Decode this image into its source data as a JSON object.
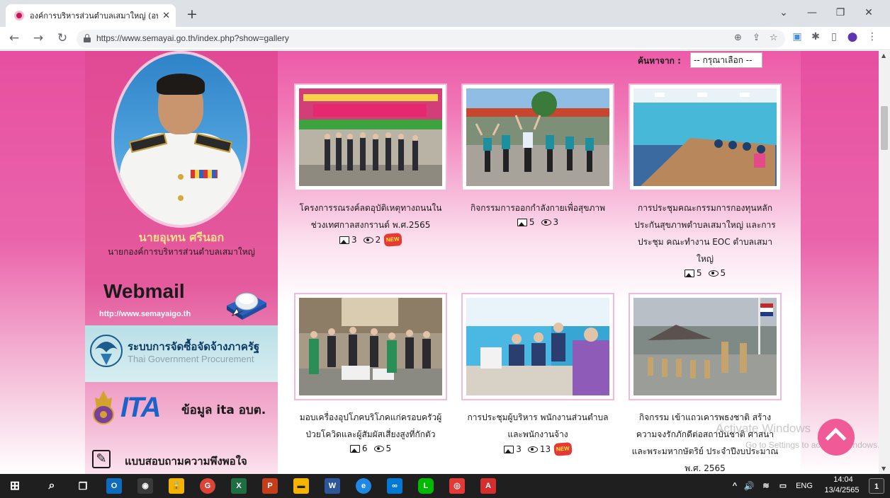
{
  "browser": {
    "tab_title": "องค์การบริหารส่วนตำบลเสมาใหญ่ (อบ",
    "tab_close": "✕",
    "new_tab": "+",
    "window_controls": {
      "dropdown": "⌄",
      "minimize": "—",
      "restore": "❐",
      "close": "✕"
    },
    "nav": {
      "back": "←",
      "forward": "→",
      "reload": "↻"
    },
    "url": "https://www.semayai.go.th/index.php?show=gallery",
    "omnibox_icons": {
      "zoom": "⊕",
      "share": "⇪",
      "bookmark": "☆"
    },
    "extension_icons": {
      "ext": "▣",
      "puzzle": "✱",
      "sidepanel": "▯",
      "profile": "●",
      "menu": "⋮"
    }
  },
  "sidebar": {
    "official_name": "นายอุเทน ศรีนอก",
    "official_title": "นายกองค์การบริหารส่วนตำบลเสมาใหญ่",
    "webmail_label": "Webmail",
    "webmail_url": "http://www.semayaigo.th",
    "gprocure_th": "ระบบการจัดซื้อจัดจ้างภาครัฐ",
    "gprocure_en": "Thai Government Procurement",
    "ita_logo": "ITA",
    "ita_text": "ข้อมูล ita อบต.",
    "survey_icon": "✎",
    "survey_text": "แบบสอบถามความพึงพอใจ"
  },
  "search": {
    "label": "ค้นหาจาก :",
    "selected": "-- กรุณาเลือก --"
  },
  "gallery": [
    {
      "caption": "โครงการรณรงค์ลดอุบัติเหตุทางถนนในช่วงเทศกาลสงกรานต์ พ.ศ.2565",
      "images": "3",
      "views": "2",
      "new_label": "NEW"
    },
    {
      "caption": "กิจกรรมการออกกำลังกายเพื่อสุขภาพ",
      "images": "5",
      "views": "3"
    },
    {
      "caption": "การประชุมคณะกรรมการกองทุนหลักประกันสุขภาพตำบลเสมาใหญ่ และการประชุม คณะทำงาน EOC ตำบลเสมาใหญ่",
      "images": "5",
      "views": "5"
    },
    {
      "caption": "มอบเครื่องอุปโภคบริโภคแก่ครอบครัวผู้ป่วยโควิดและผู้สัมผัสเสี่ยงสูงที่กักตัว",
      "images": "6",
      "views": "5"
    },
    {
      "caption": "การประชุมผู้บริหาร พนักงานส่วนตำบลและพนักงานจ้าง",
      "images": "3",
      "views": "13",
      "new_label": "NEW"
    },
    {
      "caption": "กิจกรรม เข้าแถวเคารพธงชาติ สร้างความจงรักภักดีต่อสถาบันชาติ ศาสนาและพระมหากษัตริย์ ประจำปีงบประมาณ พ.ศ. 2565",
      "images": "",
      "views": ""
    }
  ],
  "watermark": {
    "line1": "Activate Windows",
    "line2": "Go to Settings to activate Windows."
  },
  "taskbar": {
    "start": "⊞",
    "search": "⌕",
    "taskview": "❐",
    "apps": [
      "O",
      "◉",
      "🔒",
      "G",
      "X",
      "P",
      "▬",
      "W",
      "e",
      "∞",
      "L",
      "◎",
      "A"
    ],
    "tray": {
      "chevron": "^",
      "speaker": "🔊",
      "network": "≋",
      "battery": "▭",
      "lang": "ENG",
      "notify": "1"
    },
    "time": "14:04",
    "date": "13/4/2565"
  }
}
